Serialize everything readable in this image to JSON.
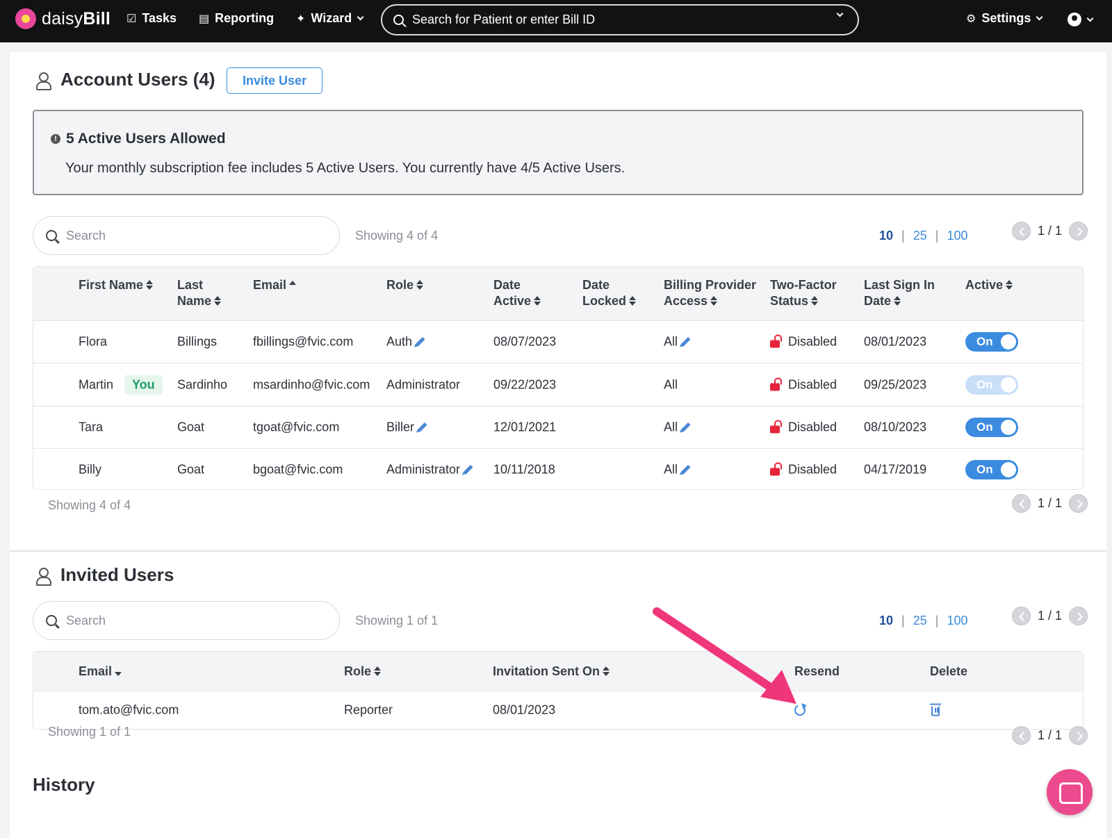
{
  "nav": {
    "logo_pre": "daisy",
    "logo_bold": "Bill",
    "tasks": "Tasks",
    "reporting": "Reporting",
    "wizard": "Wizard",
    "search_placeholder": "Search for Patient or enter Bill ID",
    "settings": "Settings"
  },
  "account_users": {
    "title": "Account Users (4)",
    "invite_button": "Invite User",
    "notice_title": "5 Active Users Allowed",
    "notice_body": "Your monthly subscription fee includes 5 Active Users. You currently have 4/5 Active Users.",
    "search_placeholder": "Search",
    "showing_top": "Showing 4 of 4",
    "showing_bottom": "Showing 4 of 4",
    "page_sizes": [
      "10",
      "25",
      "100"
    ],
    "selected_page_size": "10",
    "page": "1 / 1",
    "columns": {
      "first_name": "First Name",
      "last_name_1": "Last",
      "last_name_2": "Name",
      "email": "Email",
      "role": "Role",
      "date_active_1": "Date",
      "date_active_2": "Active",
      "date_locked_1": "Date",
      "date_locked_2": "Locked",
      "billing_1": "Billing Provider",
      "billing_2": "Access",
      "twofactor_1": "Two-Factor",
      "twofactor_2": "Status",
      "last_sign_1": "Last Sign In",
      "last_sign_2": "Date",
      "active": "Active"
    },
    "you_badge": "You",
    "rows": [
      {
        "first": "Flora",
        "last": "Billings",
        "email": "fbillings@fvic.com",
        "role": "Auth",
        "date_active": "08/07/2023",
        "date_locked": "",
        "billing": "All",
        "twofactor": "Disabled",
        "last_sign": "08/01/2023",
        "active": "On"
      },
      {
        "first": "Martin",
        "last": "Sardinho",
        "email": "msardinho@fvic.com",
        "role": "Administrator",
        "date_active": "09/22/2023",
        "date_locked": "",
        "billing": "All",
        "twofactor": "Disabled",
        "last_sign": "09/25/2023",
        "active": "On"
      },
      {
        "first": "Tara",
        "last": "Goat",
        "email": "tgoat@fvic.com",
        "role": "Biller",
        "date_active": "12/01/2021",
        "date_locked": "",
        "billing": "All",
        "twofactor": "Disabled",
        "last_sign": "08/10/2023",
        "active": "On"
      },
      {
        "first": "Billy",
        "last": "Goat",
        "email": "bgoat@fvic.com",
        "role": "Administrator",
        "date_active": "10/11/2018",
        "date_locked": "",
        "billing": "All",
        "twofactor": "Disabled",
        "last_sign": "04/17/2019",
        "active": "On"
      }
    ]
  },
  "invited_users": {
    "title": "Invited Users",
    "search_placeholder": "Search",
    "showing_top": "Showing 1 of 1",
    "showing_bottom": "Showing 1 of 1",
    "page_sizes": [
      "10",
      "25",
      "100"
    ],
    "page": "1 / 1",
    "columns": {
      "email": "Email",
      "role": "Role",
      "sent_on": "Invitation Sent On",
      "resend": "Resend",
      "delete": "Delete"
    },
    "rows": [
      {
        "email": "tom.ato@fvic.com",
        "role": "Reporter",
        "sent_on": "08/01/2023"
      }
    ]
  },
  "history": {
    "title": "History"
  },
  "colors": {
    "accent": "#3b8be0",
    "annotation_arrow": "#f0367a",
    "lock_red": "#e8233a",
    "you_green": "#1c9c63"
  }
}
